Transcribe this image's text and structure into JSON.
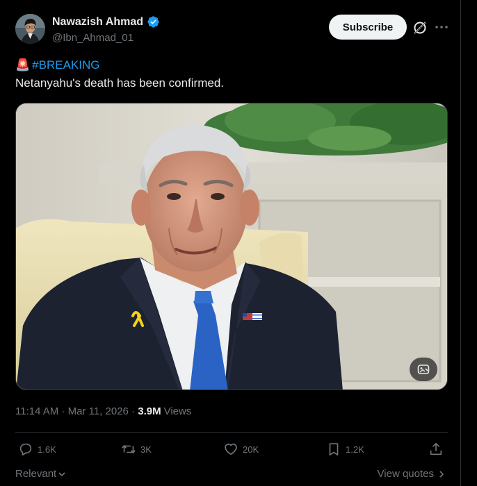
{
  "author": {
    "name": "Nawazish Ahmad",
    "handle": "@Ibn_Ahmad_01",
    "verified": true
  },
  "header": {
    "subscribe_label": "Subscribe",
    "icons": [
      "grok-icon",
      "more-icon"
    ]
  },
  "post": {
    "emoji": "🚨",
    "hashtag": "#BREAKING",
    "text": "Netanyahu's death has been confirmed."
  },
  "meta": {
    "time": "11:14 AM",
    "separator": " · ",
    "date": "Mar 11, 2026",
    "views_count": "3.9M",
    "views_label": "Views"
  },
  "actions": {
    "replies": "1.6K",
    "reposts": "3K",
    "likes": "20K",
    "bookmarks": "1.2K"
  },
  "footer": {
    "sort_label": "Relevant",
    "view_quotes": "View quotes"
  },
  "colors": {
    "background": "#000000",
    "text": "#e7e9ea",
    "muted": "#71767b",
    "accent": "#1d9bf0",
    "border": "#2f3336"
  }
}
